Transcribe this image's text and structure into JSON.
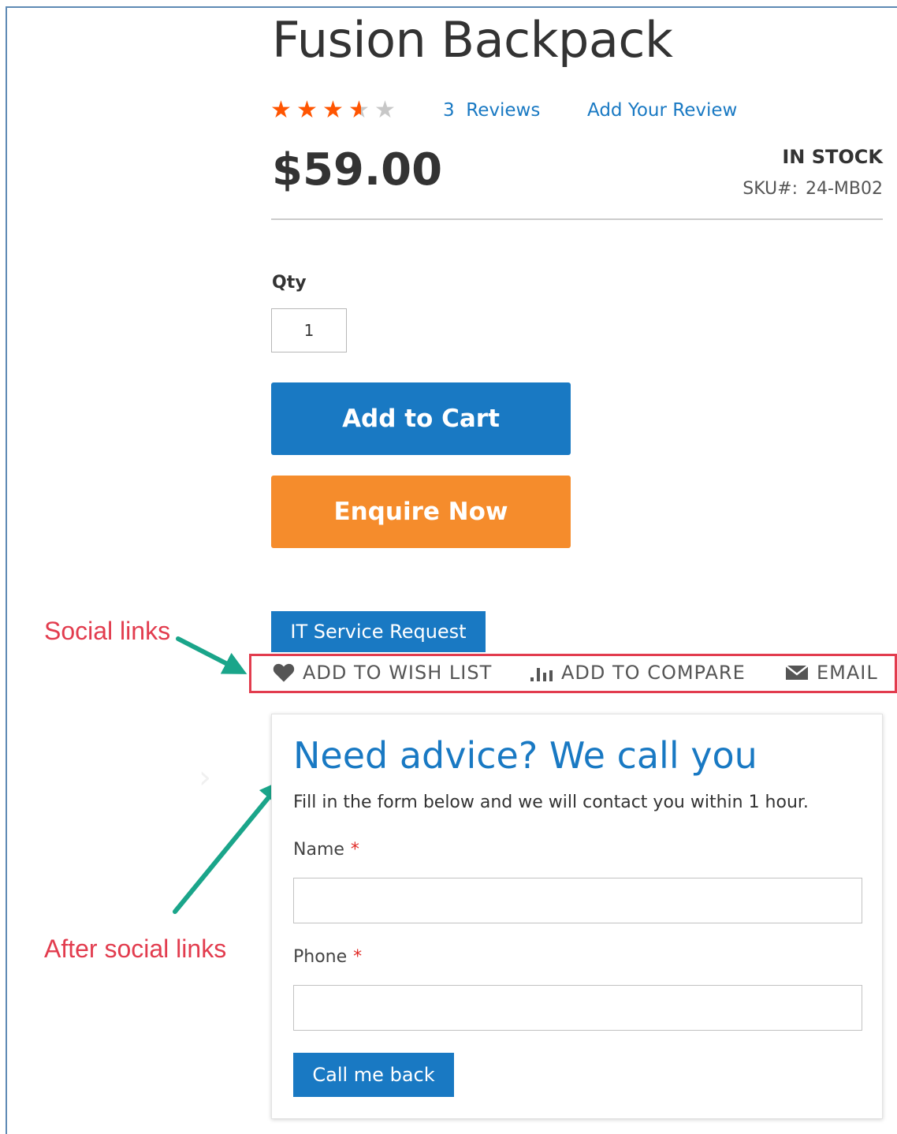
{
  "product": {
    "title": "Fusion Backpack",
    "rating_stars": 3.5,
    "rating_max": 5,
    "reviews_count": "3",
    "reviews_label": "Reviews",
    "add_review_label": "Add Your Review",
    "price": "$59.00",
    "stock_status": "IN STOCK",
    "sku_label": "SKU#:",
    "sku_value": "24-MB02"
  },
  "purchase": {
    "qty_label": "Qty",
    "qty_value": "1",
    "add_to_cart_label": "Add to Cart",
    "enquire_label": "Enquire Now",
    "it_service_label": "IT Service Request"
  },
  "social_links": {
    "wishlist_label": "ADD TO WISH LIST",
    "compare_label": "ADD TO COMPARE",
    "email_label": "EMAIL"
  },
  "annotations": {
    "social_links": "Social links",
    "after_social_links": "After social links"
  },
  "callback_form": {
    "title": "Need advice? We call you",
    "description": "Fill in the form below and we will contact you within 1 hour.",
    "name_label": "Name",
    "phone_label": "Phone",
    "required_marker": "*",
    "name_value": "",
    "phone_value": "",
    "submit_label": "Call me back"
  },
  "colors": {
    "primary_blue": "#1979c3",
    "enquire_orange": "#f58c2c",
    "star_filled": "#ff5501",
    "star_empty": "#c7c7c7",
    "annotation_red": "#e23c4e",
    "arrow_teal": "#1aa58a",
    "required_red": "#e02b27"
  }
}
